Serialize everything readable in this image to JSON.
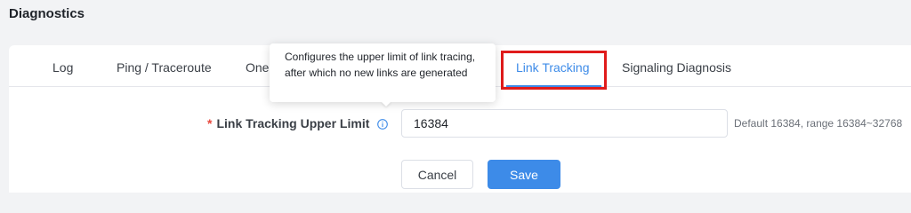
{
  "page": {
    "title": "Diagnostics"
  },
  "tabs": [
    {
      "label": "Log"
    },
    {
      "label": "Ping / Traceroute"
    },
    {
      "label": "One"
    },
    {
      "label": "Link Tracking",
      "active": true
    },
    {
      "label": "Signaling Diagnosis"
    }
  ],
  "tooltip": {
    "text": "Configures the upper limit of link tracing, after which no new links are generated"
  },
  "form": {
    "required_marker": "*",
    "label": "Link Tracking Upper Limit",
    "info_icon": "info-circle-icon",
    "value": "16384",
    "hint": "Default 16384, range 16384~32768"
  },
  "buttons": {
    "cancel": "Cancel",
    "save": "Save"
  },
  "colors": {
    "accent": "#3d8be8",
    "highlight": "#e01b1b",
    "required": "#e8473c"
  }
}
